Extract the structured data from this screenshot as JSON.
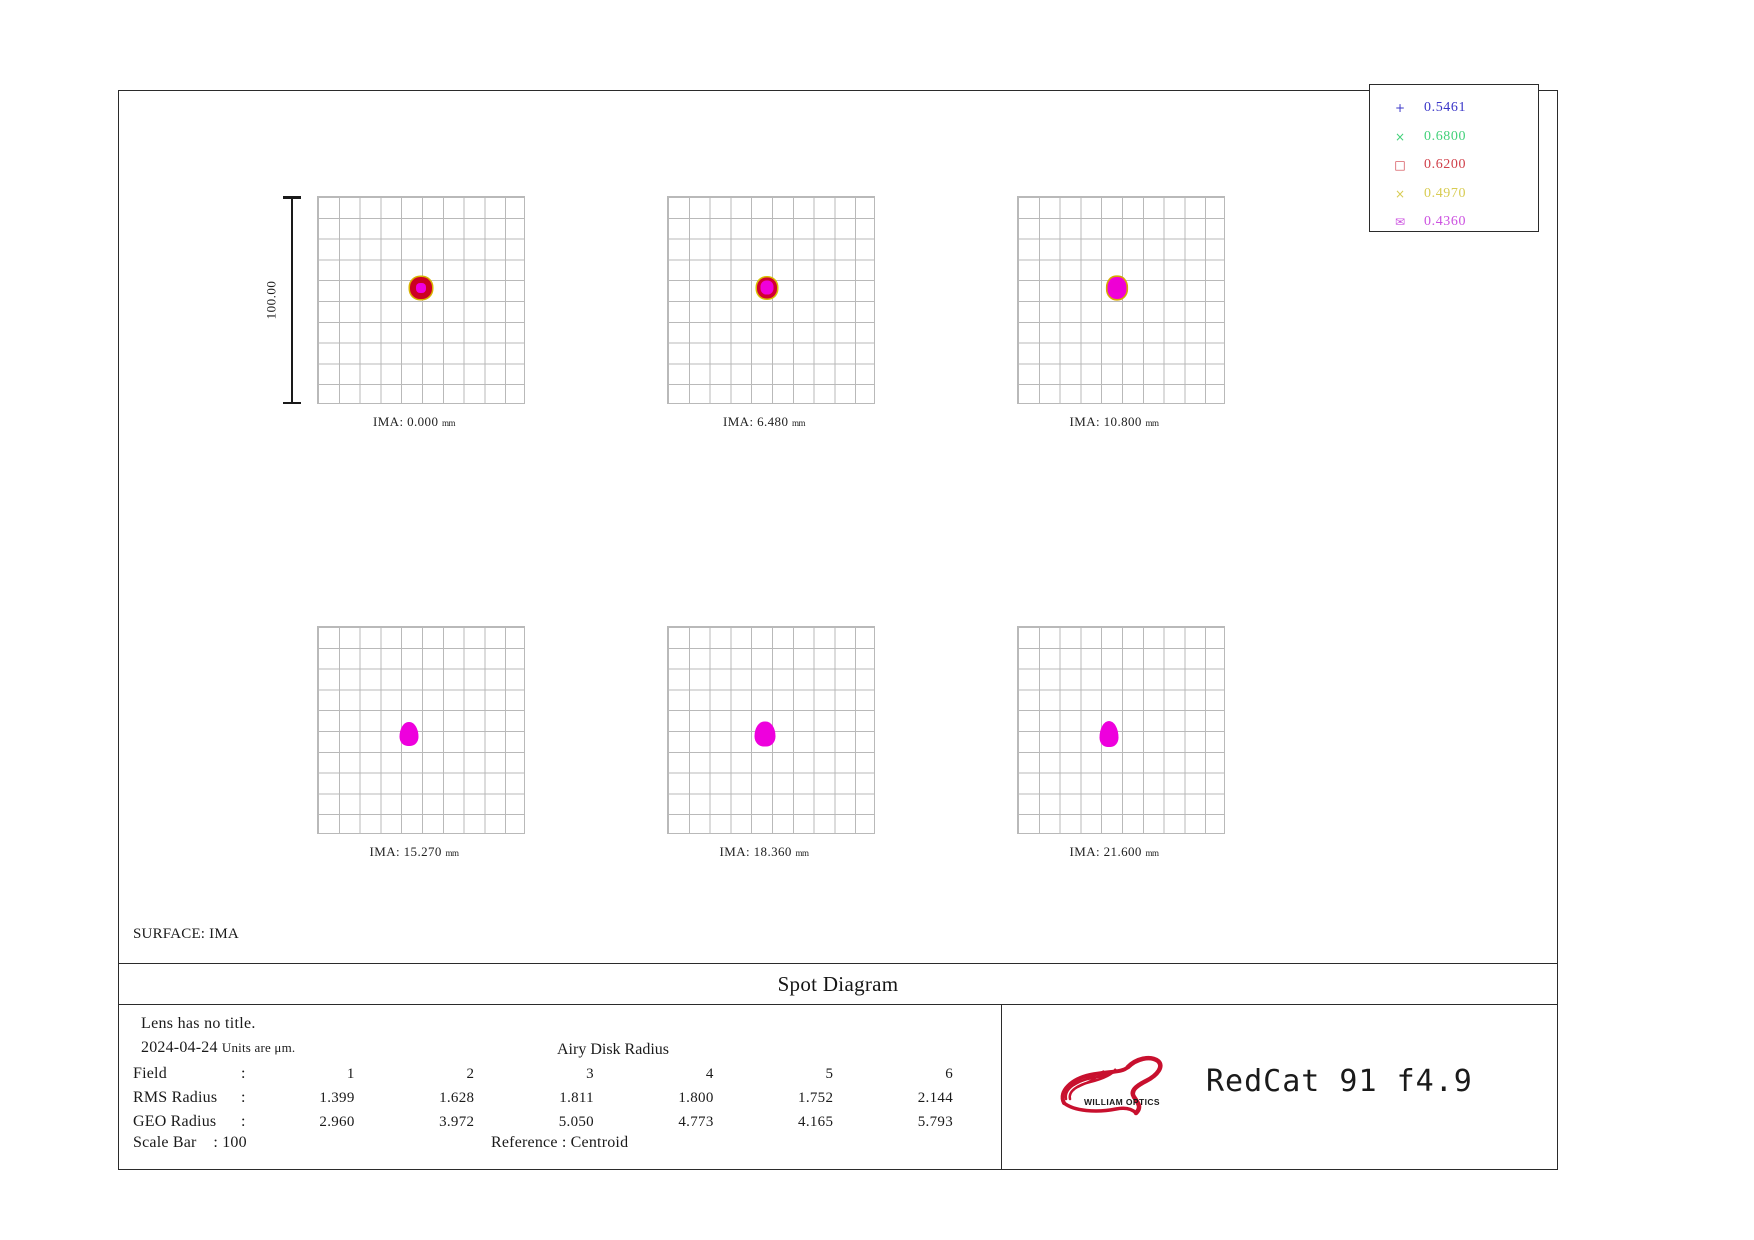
{
  "legend": {
    "entries": [
      {
        "marker": "+",
        "wavelength": "0.5461",
        "color": "#3a36c8"
      },
      {
        "marker": "×",
        "wavelength": "0.6800",
        "color": "#43d17a"
      },
      {
        "marker": "□",
        "wavelength": "0.6200",
        "color": "#d0404a"
      },
      {
        "marker": "×",
        "wavelength": "0.4970",
        "color": "#d8cc52"
      },
      {
        "marker": "✉",
        "wavelength": "0.4360",
        "color": "#cc52e0"
      }
    ]
  },
  "scale_bar": {
    "label": "100.00"
  },
  "panels": [
    {
      "ima_label": "IMA:  0.000",
      "unit": "mm",
      "blob_class": "blob-a",
      "x_pct": 50,
      "y_pct": 44
    },
    {
      "ima_label": "IMA:  6.480",
      "unit": "mm",
      "blob_class": "blob-b",
      "x_pct": 48,
      "y_pct": 44
    },
    {
      "ima_label": "IMA: 10.800",
      "unit": "mm",
      "blob_class": "blob-c",
      "x_pct": 48,
      "y_pct": 44
    },
    {
      "ima_label": "IMA: 15.270",
      "unit": "mm",
      "blob_class": "blob-d",
      "x_pct": 44,
      "y_pct": 52
    },
    {
      "ima_label": "IMA: 18.360",
      "unit": "mm",
      "blob_class": "blob-e",
      "x_pct": 47,
      "y_pct": 52
    },
    {
      "ima_label": "IMA: 21.600",
      "unit": "mm",
      "blob_class": "blob-f",
      "x_pct": 44,
      "y_pct": 52
    }
  ],
  "surface": "SURFACE: IMA",
  "title": "Spot Diagram",
  "footer": {
    "lens_title": "Lens has no title.",
    "date": "2024-04-24",
    "units": "Units are μm.",
    "airy_header": "Airy Disk Radius",
    "field_label": "Field",
    "rms_label": "RMS Radius",
    "geo_label": "GEO Radius",
    "colon": ":",
    "scale_bar_label": "Scale Bar",
    "scale_bar_colon": ": 100",
    "reference_label": "Reference  :  Centroid"
  },
  "brand": {
    "logo_text": "WILLIAM OPTICS",
    "product": "RedCat 91  f4.9",
    "logo_color": "#c8102e"
  },
  "chart_data": {
    "type": "scatter",
    "title": "Spot Diagram",
    "subtitle": "RedCat 91  f4.9",
    "surface": "IMA",
    "units": "μm",
    "reference": "Centroid",
    "scale_bar_um": 100,
    "grid": true,
    "grid_divisions": 10,
    "wavelengths_um": [
      0.5461,
      0.68,
      0.62,
      0.497,
      0.436
    ],
    "fields": [
      1,
      2,
      3,
      4,
      5,
      6
    ],
    "field_heights_mm": [
      0.0,
      6.48,
      10.8,
      15.27,
      18.36,
      21.6
    ],
    "rms_radius_um": [
      1.399,
      1.628,
      1.811,
      1.8,
      1.752,
      2.144
    ],
    "geo_radius_um": [
      2.96,
      3.972,
      5.05,
      4.773,
      4.165,
      5.793
    ],
    "xlabel": "",
    "ylabel": "",
    "legend_position": "top-right"
  },
  "table": {
    "rows": [
      {
        "label": "Field",
        "values": [
          "1",
          "2",
          "3",
          "4",
          "5",
          "6"
        ]
      },
      {
        "label": "RMS Radius",
        "values": [
          "1.399",
          "1.628",
          "1.811",
          "1.800",
          "1.752",
          "2.144"
        ]
      },
      {
        "label": "GEO Radius",
        "values": [
          "2.960",
          "3.972",
          "5.050",
          "4.773",
          "4.165",
          "5.793"
        ]
      }
    ]
  }
}
